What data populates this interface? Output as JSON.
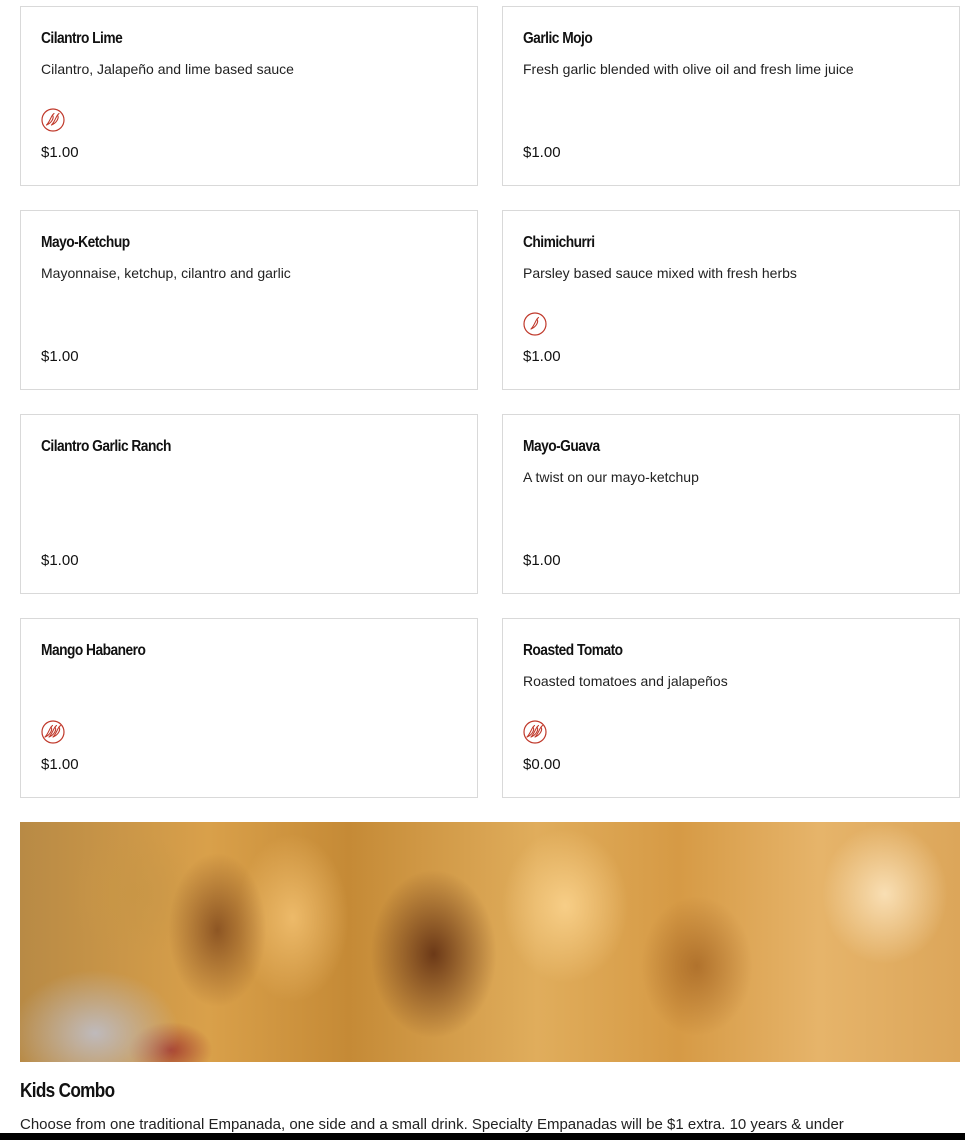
{
  "colors": {
    "accent": "#c0392b",
    "border": "#d9d9d9"
  },
  "items": [
    {
      "name": "Cilantro Lime",
      "description": "Cilantro, Jalapeño and lime based sauce",
      "spice_icon": "pepper-medium-icon",
      "spice_level": 2,
      "price": "$1.00"
    },
    {
      "name": "Garlic Mojo",
      "description": "Fresh garlic blended with olive oil and fresh lime juice",
      "spice_icon": "",
      "spice_level": 0,
      "price": "$1.00"
    },
    {
      "name": "Mayo-Ketchup",
      "description": "Mayonnaise, ketchup, cilantro and garlic",
      "spice_icon": "",
      "spice_level": 0,
      "price": "$1.00"
    },
    {
      "name": "Chimichurri",
      "description": "Parsley based sauce mixed with fresh herbs",
      "spice_icon": "pepper-mild-icon",
      "spice_level": 1,
      "price": "$1.00"
    },
    {
      "name": "Cilantro Garlic Ranch",
      "description": "",
      "spice_icon": "",
      "spice_level": 0,
      "price": "$1.00"
    },
    {
      "name": "Mayo-Guava",
      "description": "A twist on our mayo-ketchup",
      "spice_icon": "",
      "spice_level": 0,
      "price": "$1.00"
    },
    {
      "name": "Mango Habanero",
      "description": "",
      "spice_icon": "pepper-hot-icon",
      "spice_level": 3,
      "price": "$1.00"
    },
    {
      "name": "Roasted Tomato",
      "description": "Roasted tomatoes and jalapeños",
      "spice_icon": "pepper-hot-icon",
      "spice_level": 3,
      "price": "$0.00"
    }
  ],
  "section": {
    "title": "Kids Combo",
    "description": "Choose from one traditional Empanada, one side and a small drink. Specialty Empanadas will be $1 extra. 10 years & under"
  }
}
